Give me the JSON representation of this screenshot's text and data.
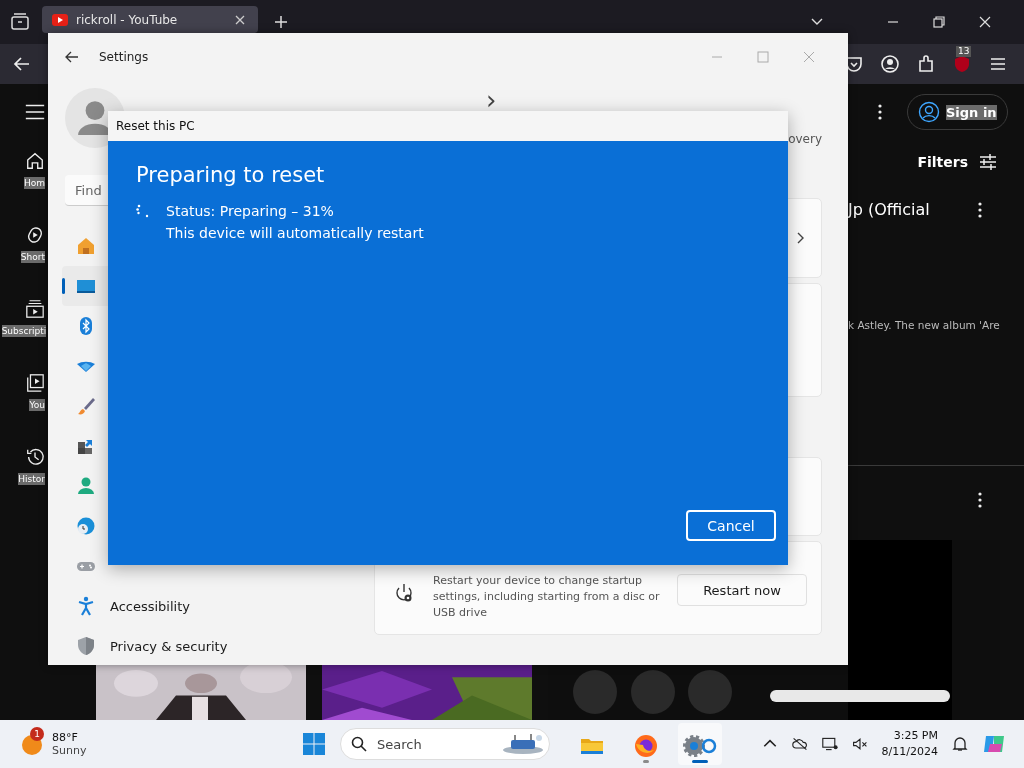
{
  "browser": {
    "tab": {
      "title": "rickroll - YouTube",
      "selected": true
    },
    "extension_badge": "13"
  },
  "youtube": {
    "sidebar": [
      {
        "label": "Hom"
      },
      {
        "label": "Short"
      },
      {
        "label": "Subscripti"
      },
      {
        "label": "You"
      },
      {
        "label": "Histor"
      }
    ],
    "sign_in": "Sign in",
    "filters": "Filters",
    "video_title": "Jp (Official",
    "description": "k Astley. The new album 'Are"
  },
  "settings": {
    "title": "Settings",
    "search_placeholder": "Find",
    "breadcrumb": {
      "separator": "›"
    },
    "related": "overy",
    "nav": [
      {
        "selected": false
      },
      {
        "selected": true
      },
      {
        "selected": false
      },
      {
        "selected": false
      },
      {
        "selected": false
      },
      {
        "selected": false
      },
      {
        "selected": false
      },
      {
        "selected": false
      },
      {
        "selected": false
      },
      {
        "label": "Accessibility",
        "selected": false
      },
      {
        "label": "Privacy & security",
        "selected": false
      }
    ],
    "advanced_startup": {
      "description": "Restart your device to change startup settings, including starting from a disc or USB drive",
      "button": "Restart now"
    }
  },
  "dialog": {
    "title": "Reset this PC",
    "heading": "Preparing to reset",
    "status": "Status: Preparing – 31%",
    "note": "This device will automatically restart",
    "cancel": "Cancel"
  },
  "taskbar": {
    "weather": {
      "badge": "1",
      "temperature": "88°F",
      "condition": "Sunny"
    },
    "search_placeholder": "Search",
    "apps": [
      {
        "running": false,
        "selected": false
      },
      {
        "running": true,
        "selected": false
      },
      {
        "running": true,
        "selected": true
      }
    ],
    "time": "3:25 PM",
    "date": "8/11/2024"
  }
}
